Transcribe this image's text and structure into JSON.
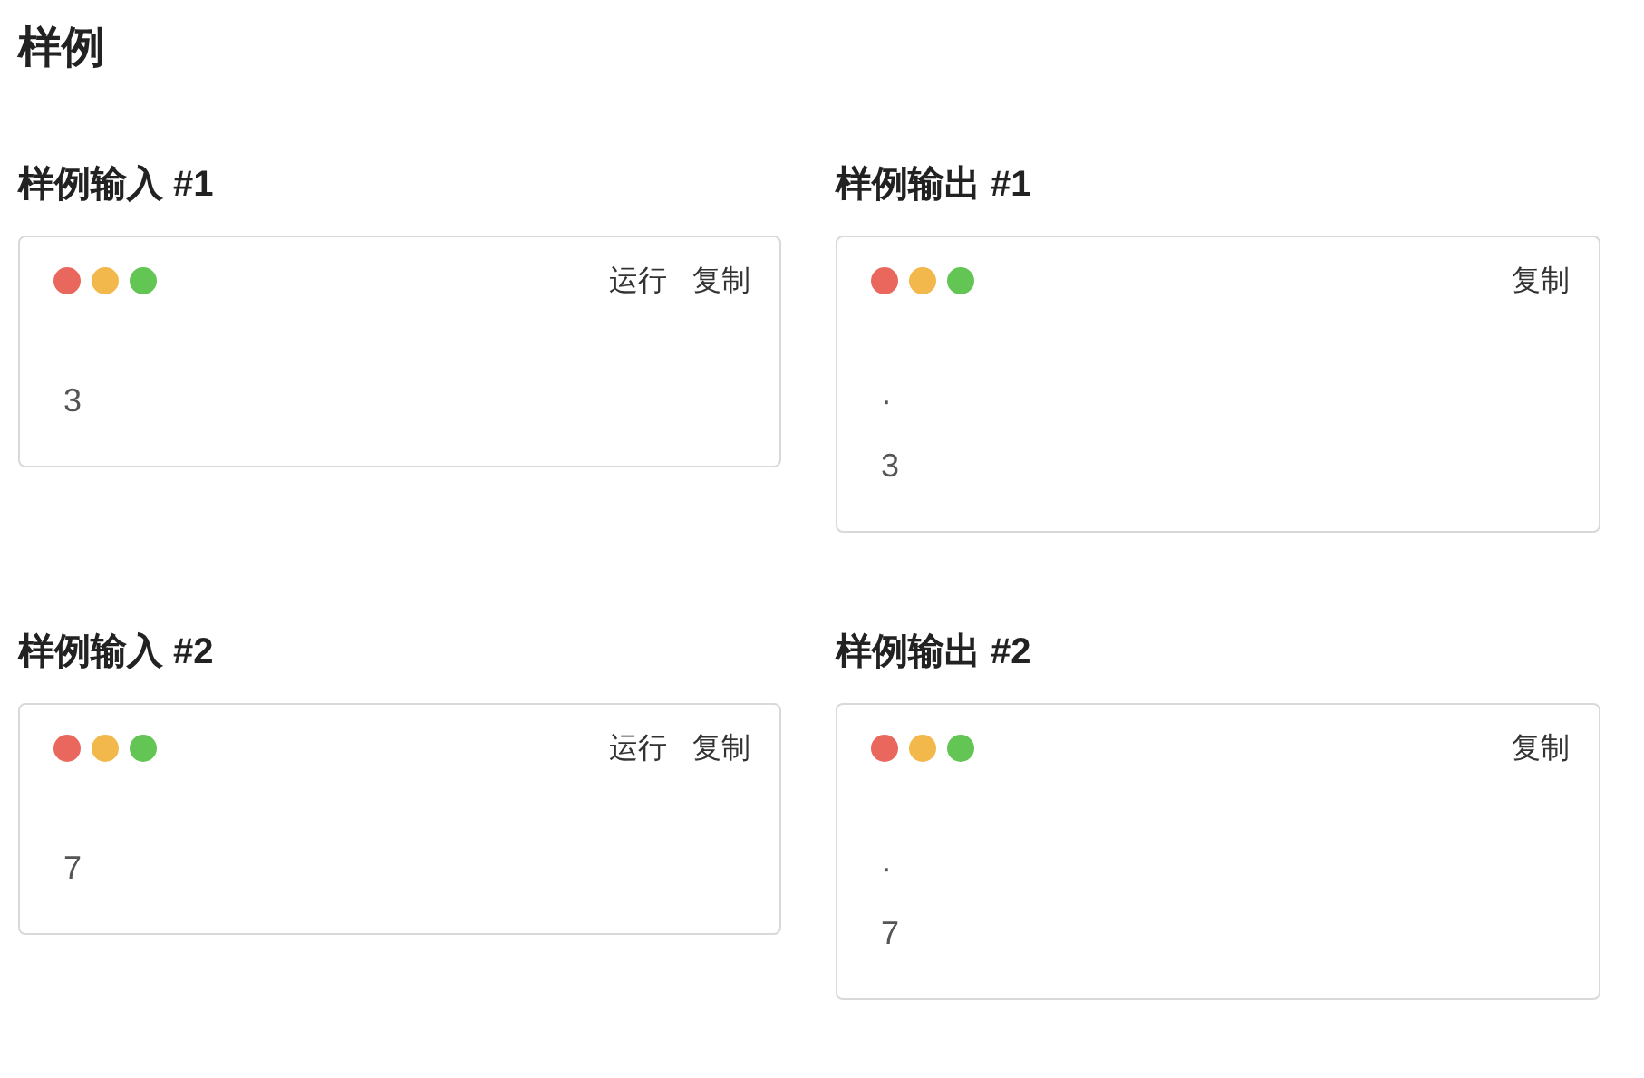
{
  "title": "样例",
  "samples": [
    {
      "input": {
        "heading": "样例输入 #1",
        "actions": [
          "运行",
          "复制"
        ],
        "lines": [
          "3"
        ]
      },
      "output": {
        "heading": "样例输出 #1",
        "actions": [
          "复制"
        ],
        "lines": [
          "·",
          "3"
        ]
      }
    },
    {
      "input": {
        "heading": "样例输入 #2",
        "actions": [
          "运行",
          "复制"
        ],
        "lines": [
          "7"
        ]
      },
      "output": {
        "heading": "样例输出 #2",
        "actions": [
          "复制"
        ],
        "lines": [
          "·",
          "7"
        ]
      }
    }
  ]
}
